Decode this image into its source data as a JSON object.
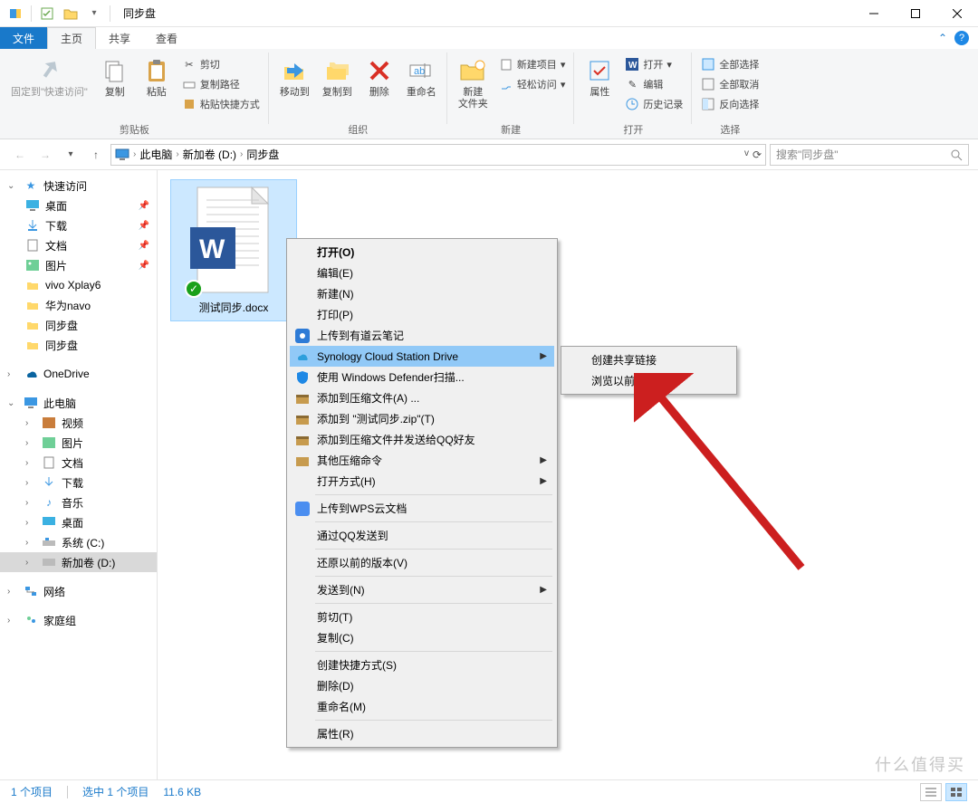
{
  "window": {
    "title": "同步盘"
  },
  "tabs": {
    "file": "文件",
    "home": "主页",
    "share": "共享",
    "view": "查看"
  },
  "ribbon": {
    "clipboard": {
      "label": "剪贴板",
      "pin": "固定到\"快速访问\"",
      "copy": "复制",
      "paste": "粘贴",
      "cut": "剪切",
      "copypath": "复制路径",
      "pastesc": "粘贴快捷方式"
    },
    "organize": {
      "label": "组织",
      "moveto": "移动到",
      "copyto": "复制到",
      "delete": "删除",
      "rename": "重命名"
    },
    "new": {
      "label": "新建",
      "newfolder": "新建\n文件夹",
      "newitem": "新建项目",
      "easy": "轻松访问"
    },
    "open": {
      "label": "打开",
      "properties": "属性",
      "open": "打开",
      "edit": "编辑",
      "history": "历史记录"
    },
    "select": {
      "label": "选择",
      "all": "全部选择",
      "none": "全部取消",
      "invert": "反向选择"
    }
  },
  "breadcrumb": {
    "root_icon": "pc",
    "pc": "此电脑",
    "vol": "新加卷 (D:)",
    "folder": "同步盘"
  },
  "search": {
    "placeholder": "搜索\"同步盘\""
  },
  "tree": {
    "quick": "快速访问",
    "desktop": "桌面",
    "downloads": "下载",
    "documents": "文档",
    "pictures": "图片",
    "vivo": "vivo Xplay6",
    "huawei": "华为navo",
    "sync1": "同步盘",
    "sync2": "同步盘",
    "onedrive": "OneDrive",
    "thispc": "此电脑",
    "videos": "视频",
    "pictures2": "图片",
    "documents2": "文档",
    "downloads2": "下载",
    "music": "音乐",
    "desktop2": "桌面",
    "sysc": "系统 (C:)",
    "vold": "新加卷 (D:)",
    "network": "网络",
    "homegroup": "家庭组"
  },
  "file": {
    "name": "测试同步.docx"
  },
  "context": {
    "open": "打开(O)",
    "edit": "编辑(E)",
    "new": "新建(N)",
    "print": "打印(P)",
    "youdao": "上传到有道云笔记",
    "synology": "Synology Cloud Station Drive",
    "defender": "使用 Windows Defender扫描...",
    "zipadd": "添加到压缩文件(A) ...",
    "zipto": "添加到 \"测试同步.zip\"(T)",
    "zipqq": "添加到压缩文件并发送给QQ好友",
    "othercomp": "其他压缩命令",
    "openwith": "打开方式(H)",
    "wps": "上传到WPS云文档",
    "qqsend": "通过QQ发送到",
    "restore": "还原以前的版本(V)",
    "sendto": "发送到(N)",
    "cut": "剪切(T)",
    "copy": "复制(C)",
    "shortcut": "创建快捷方式(S)",
    "delete": "删除(D)",
    "rename": "重命名(M)",
    "properties": "属性(R)"
  },
  "submenu": {
    "share": "创建共享链接",
    "browse": "浏览以前的版本"
  },
  "status": {
    "count": "1 个项目",
    "selected": "选中 1 个项目",
    "size": "11.6 KB"
  },
  "watermark": "什么值得买"
}
